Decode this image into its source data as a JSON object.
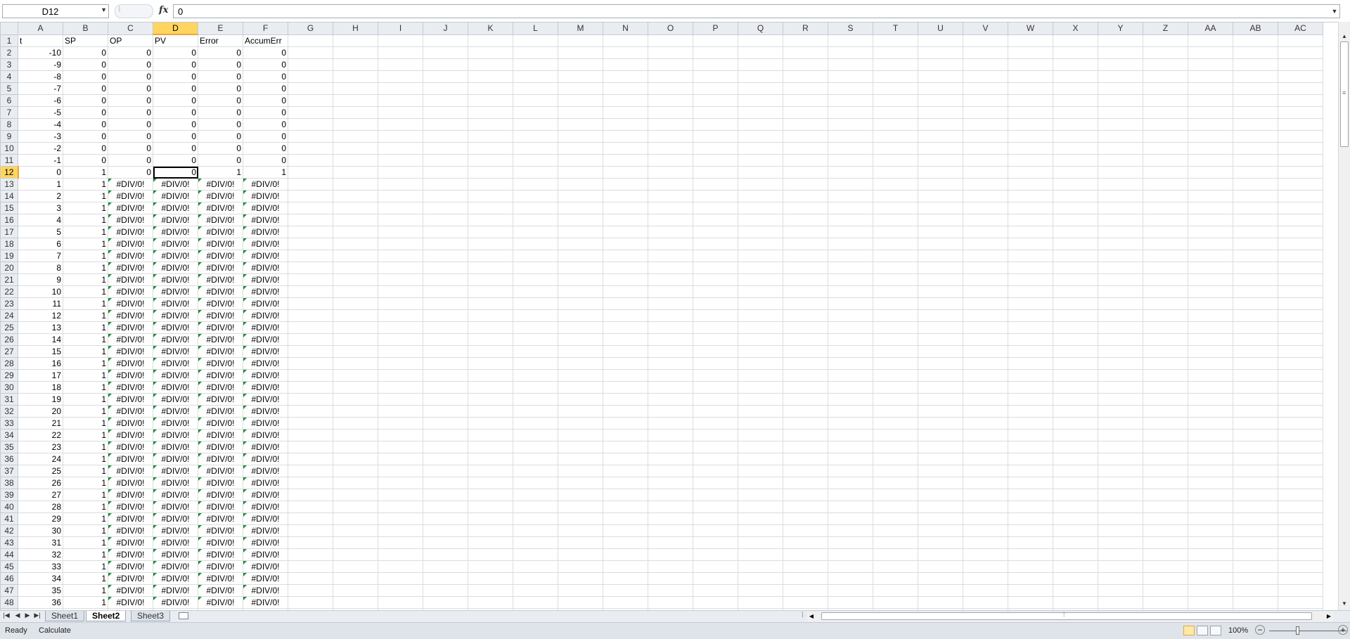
{
  "name_box": {
    "value": "D12"
  },
  "formula_bar": {
    "value": "0",
    "fx": "fx"
  },
  "columns": [
    "A",
    "B",
    "C",
    "D",
    "E",
    "F",
    "G",
    "H",
    "I",
    "J",
    "K",
    "L",
    "M",
    "N",
    "O",
    "P",
    "Q",
    "R",
    "S",
    "T",
    "U",
    "V",
    "W",
    "X",
    "Y",
    "Z",
    "AA",
    "AB",
    "AC"
  ],
  "selected_column": "D",
  "selected_row": 12,
  "selected_cell": "D12",
  "headers": [
    "t",
    "SP",
    "OP",
    "PV",
    "Error",
    "AccumErr"
  ],
  "rows_before": [
    [
      "-10",
      "0",
      "0",
      "0",
      "0",
      "0"
    ],
    [
      "-9",
      "0",
      "0",
      "0",
      "0",
      "0"
    ],
    [
      "-8",
      "0",
      "0",
      "0",
      "0",
      "0"
    ],
    [
      "-7",
      "0",
      "0",
      "0",
      "0",
      "0"
    ],
    [
      "-6",
      "0",
      "0",
      "0",
      "0",
      "0"
    ],
    [
      "-5",
      "0",
      "0",
      "0",
      "0",
      "0"
    ],
    [
      "-4",
      "0",
      "0",
      "0",
      "0",
      "0"
    ],
    [
      "-3",
      "0",
      "0",
      "0",
      "0",
      "0"
    ],
    [
      "-2",
      "0",
      "0",
      "0",
      "0",
      "0"
    ],
    [
      "-1",
      "0",
      "0",
      "0",
      "0",
      "0"
    ],
    [
      "0",
      "1",
      "0",
      "0",
      "1",
      "1"
    ]
  ],
  "error_rows": {
    "t_values": [
      "1",
      "2",
      "3",
      "4",
      "5",
      "6",
      "7",
      "8",
      "9",
      "10",
      "11",
      "12",
      "13",
      "14",
      "15",
      "16",
      "17",
      "18",
      "19",
      "20",
      "21",
      "22",
      "23",
      "24",
      "25",
      "26",
      "27",
      "28",
      "29",
      "30",
      "31",
      "32",
      "33",
      "34",
      "35",
      "36"
    ],
    "sp_value": "1",
    "error_text": "#DIV/0!"
  },
  "sheet_tabs": [
    "Sheet1",
    "Sheet2",
    "Sheet3"
  ],
  "active_sheet": "Sheet2",
  "status": {
    "ready": "Ready",
    "calculate": "Calculate",
    "zoom": "100%"
  },
  "zoom_percent": 100,
  "colors": {
    "selection_header": "#ffd55f",
    "error_indicator": "#1e8c3a",
    "header_bg": "#e9edf2"
  }
}
